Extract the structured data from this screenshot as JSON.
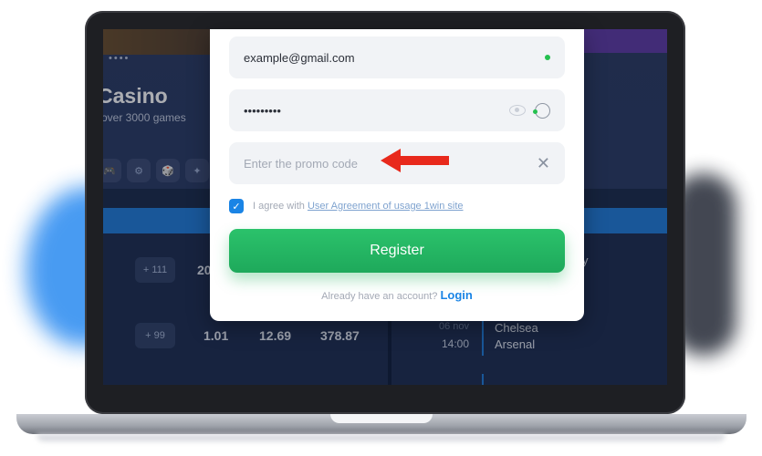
{
  "background": {
    "casino_title": "Casino",
    "casino_subtitle": "over 3000 games",
    "dots": "••••",
    "chips": [
      "🎮",
      "⚙",
      "🎲",
      "✦",
      "⚗"
    ],
    "rows": [
      {
        "pill": "+ 111",
        "value1": "20"
      },
      {
        "pill": "+ 99",
        "value1": "1.01",
        "value2": "12.69",
        "value3": "378.87"
      }
    ],
    "match": {
      "date": "06 nov",
      "time": "14:00",
      "team1": "Chelsea",
      "team2": "Arsenal",
      "partial_text": "y"
    }
  },
  "form": {
    "email_value": "example@gmail.com",
    "password_value": "•••••••••",
    "promo_placeholder": "Enter the promo code",
    "clear_symbol": "✕",
    "agree_text": "I agree with",
    "agree_link": "User Agreement of usage 1win site",
    "checkbox_mark": "✓",
    "register_label": "Register",
    "have_account_text": "Already have an account?",
    "login_label": "Login"
  },
  "colors": {
    "accent_green": "#24c04f",
    "button_green": "#1ea95b",
    "link_blue": "#1a84e5",
    "arrow_red": "#e8291c"
  }
}
